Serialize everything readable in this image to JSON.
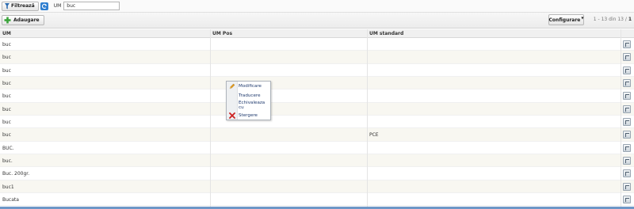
{
  "filter": {
    "button_label": "Filtrează",
    "um_label": "UM",
    "um_value": "buc"
  },
  "toolbar": {
    "add_label": "Adaugare",
    "config_label": "Configurare",
    "pager": {
      "range": "1 - 13 din 13 /",
      "pages": "1"
    }
  },
  "columns": {
    "um": "UM",
    "um_pos": "UM Pos",
    "um_standard": "UM standard"
  },
  "rows": [
    {
      "um": "buc",
      "um_pos": "",
      "um_standard": ""
    },
    {
      "um": "buc",
      "um_pos": "",
      "um_standard": ""
    },
    {
      "um": "buc",
      "um_pos": "",
      "um_standard": ""
    },
    {
      "um": "buc",
      "um_pos": "",
      "um_standard": ""
    },
    {
      "um": "buc",
      "um_pos": "",
      "um_standard": ""
    },
    {
      "um": "buc",
      "um_pos": "",
      "um_standard": ""
    },
    {
      "um": "buc",
      "um_pos": "",
      "um_standard": ""
    },
    {
      "um": "buc",
      "um_pos": "",
      "um_standard": "PCE"
    },
    {
      "um": "BUC.",
      "um_pos": "",
      "um_standard": ""
    },
    {
      "um": "buc.",
      "um_pos": "",
      "um_standard": ""
    },
    {
      "um": "Buc. 200gr.",
      "um_pos": "",
      "um_standard": ""
    },
    {
      "um": "buc1",
      "um_pos": "",
      "um_standard": ""
    },
    {
      "um": "Bucata",
      "um_pos": "",
      "um_standard": ""
    }
  ],
  "context_menu": [
    {
      "label": "Modificare",
      "icon": "pencil-icon"
    },
    {
      "label": "Traducere",
      "icon": ""
    },
    {
      "label": "Echivaleaza cu",
      "icon": ""
    },
    {
      "label": "Stergere",
      "icon": "delete-x-icon"
    }
  ],
  "colors": {
    "accent_blue": "#2f7fd0",
    "menu_text": "#1f3a6e",
    "delete_red": "#cc2222",
    "add_green": "#3aa33a"
  }
}
